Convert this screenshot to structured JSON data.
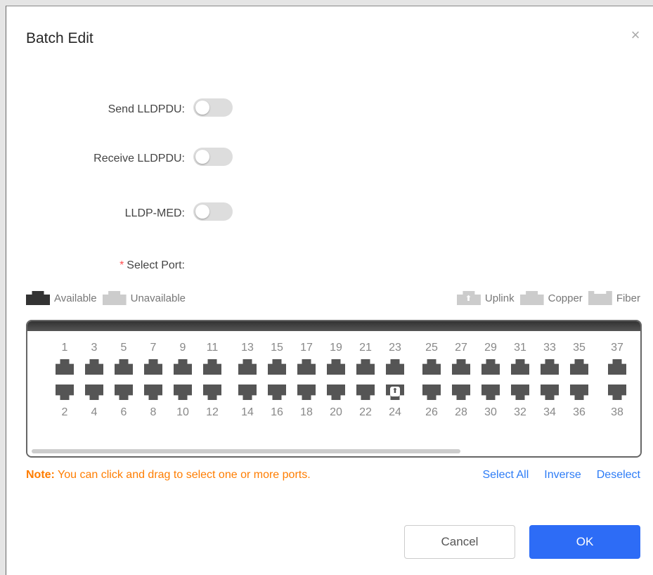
{
  "dialog": {
    "title": "Batch Edit",
    "close_icon": "close-icon"
  },
  "fields": [
    {
      "label": "Send LLDPDU:",
      "enabled": false
    },
    {
      "label": "Receive LLDPDU:",
      "enabled": false
    },
    {
      "label": "LLDP-MED:",
      "enabled": false
    }
  ],
  "select_port": {
    "required_mark": "*",
    "label": "Select Port:"
  },
  "legend": {
    "available": "Available",
    "unavailable": "Unavailable",
    "uplink": "Uplink",
    "copper": "Copper",
    "fiber": "Fiber"
  },
  "ports": {
    "groups": [
      {
        "top": [
          "1",
          "3",
          "5",
          "7",
          "9",
          "11"
        ],
        "bottom": [
          "2",
          "4",
          "6",
          "8",
          "10",
          "12"
        ]
      },
      {
        "top": [
          "13",
          "15",
          "17",
          "19",
          "21",
          "23"
        ],
        "bottom": [
          "14",
          "16",
          "18",
          "20",
          "22",
          "24"
        ]
      },
      {
        "top": [
          "25",
          "27",
          "29",
          "31",
          "33",
          "35"
        ],
        "bottom": [
          "26",
          "28",
          "30",
          "32",
          "34",
          "36"
        ]
      },
      {
        "top": [
          "37"
        ],
        "bottom": [
          "38"
        ]
      }
    ],
    "uplink_ports": [
      "24"
    ]
  },
  "note": {
    "prefix": "Note:",
    "text": " You can click and drag to select one or more ports."
  },
  "actions": {
    "select_all": "Select All",
    "inverse": "Inverse",
    "deselect": "Deselect"
  },
  "buttons": {
    "cancel": "Cancel",
    "ok": "OK"
  },
  "colors": {
    "primary": "#2d6cf6",
    "link": "#2d7cf6",
    "note": "#ff7d00",
    "required": "#ff4d4f",
    "port_available": "#555555",
    "port_unavailable": "#cccccc"
  }
}
